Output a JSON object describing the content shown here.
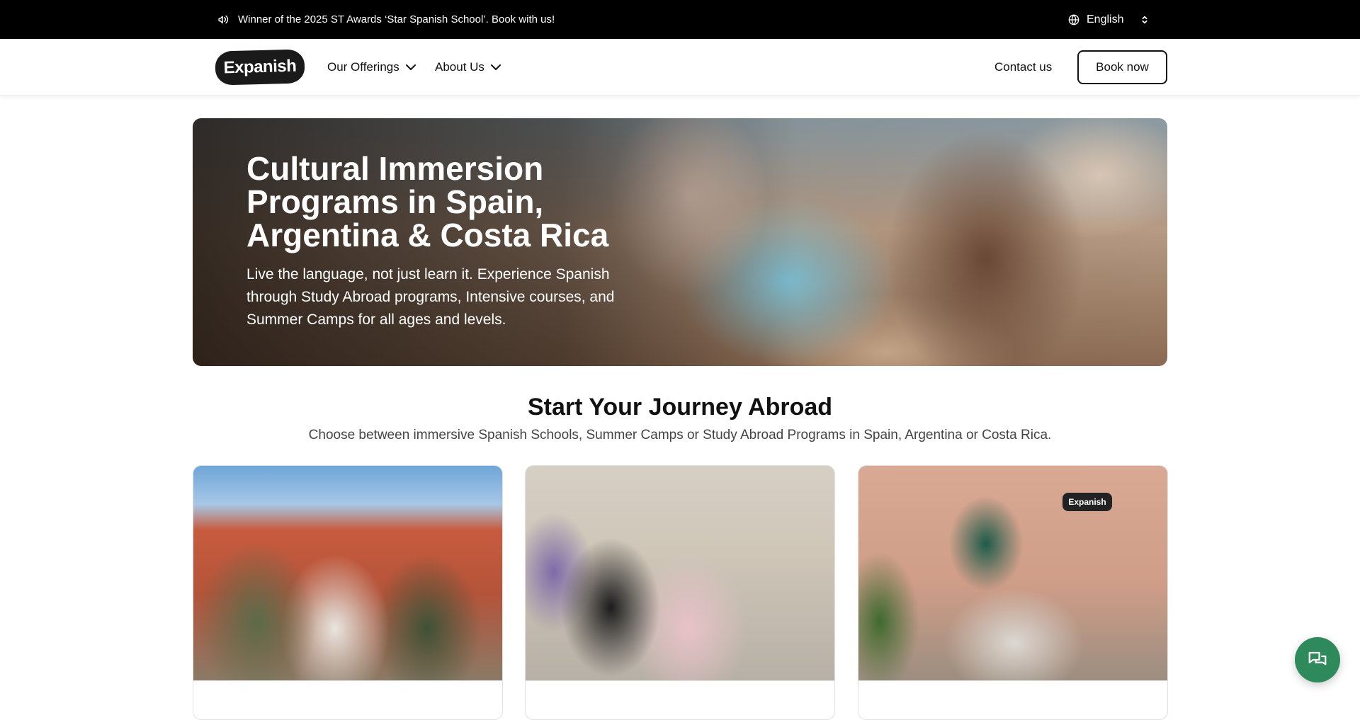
{
  "announcement": {
    "text": "Winner of the 2025 ST Awards ‘Star Spanish School’. Book with us!",
    "icon": "megaphone-icon"
  },
  "language": {
    "selected": "English",
    "icon": "globe-icon"
  },
  "nav": {
    "logo": "Expanish",
    "items": [
      {
        "label": "Our Offerings"
      },
      {
        "label": "About Us"
      }
    ],
    "contact": "Contact us",
    "book": "Book now"
  },
  "hero": {
    "title": "Cultural Immersion Programs in Spain, Argentina & Costa Rica",
    "subtitle": "Live the language, not just learn it. Experience Spanish through Study Abroad programs, Intensive courses, and Summer Camps for all ages and levels."
  },
  "journey": {
    "title": "Start Your Journey Abroad",
    "subtitle": "Choose between immersive Spanish Schools, Summer Camps or Study Abroad Programs in Spain, Argentina or Costa Rica."
  },
  "cards": [
    {
      "image": "group-of-students-photo"
    },
    {
      "image": "teens-street-photo"
    },
    {
      "image": "school-entrance-photo",
      "sign": "Expanish"
    }
  ],
  "chat": {
    "icon": "chat-icon"
  },
  "colors": {
    "topbar": "#000000",
    "accent_chat": "#2f8a5b",
    "text": "#111111"
  }
}
